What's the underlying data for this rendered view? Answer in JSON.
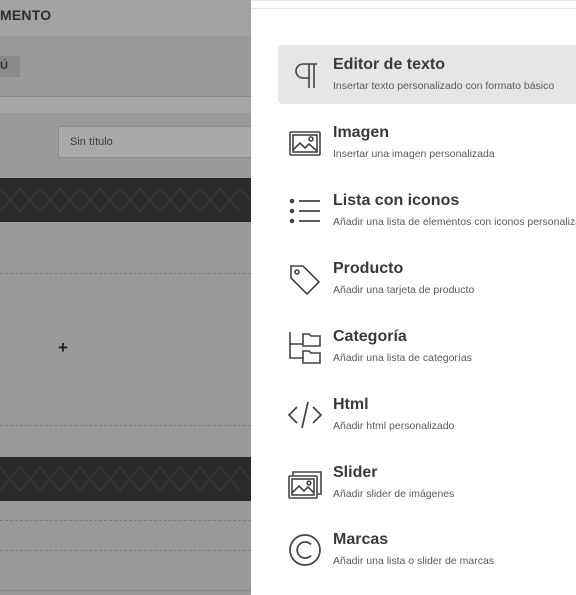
{
  "background": {
    "title": "MENTO",
    "tab_label": "Ú",
    "input_value": "Sin título",
    "add_symbol": "+"
  },
  "panel": {
    "items": [
      {
        "name": "Editor de texto",
        "description": "Insertar texto personalizado con formato básico",
        "icon": "paragraph-icon",
        "active": true
      },
      {
        "name": "Imagen",
        "description": "Insertar una imagen personalizada",
        "icon": "image-icon",
        "active": false
      },
      {
        "name": "Lista con iconos",
        "description": "Añadir una lista de elementos con iconos personalizados",
        "icon": "list-icon",
        "active": false
      },
      {
        "name": "Producto",
        "description": "Añadir una tarjeta de producto",
        "icon": "tag-icon",
        "active": false
      },
      {
        "name": "Categoría",
        "description": "Añadir una lista de categorías",
        "icon": "folder-tree-icon",
        "active": false
      },
      {
        "name": "Html",
        "description": "Añadir html personalizado",
        "icon": "code-icon",
        "active": false
      },
      {
        "name": "Slider",
        "description": "Añadir slider de imágenes",
        "icon": "slider-icon",
        "active": false
      },
      {
        "name": "Marcas",
        "description": "Añadir una lista o slider de marcas",
        "icon": "copyright-icon",
        "active": false
      }
    ]
  }
}
